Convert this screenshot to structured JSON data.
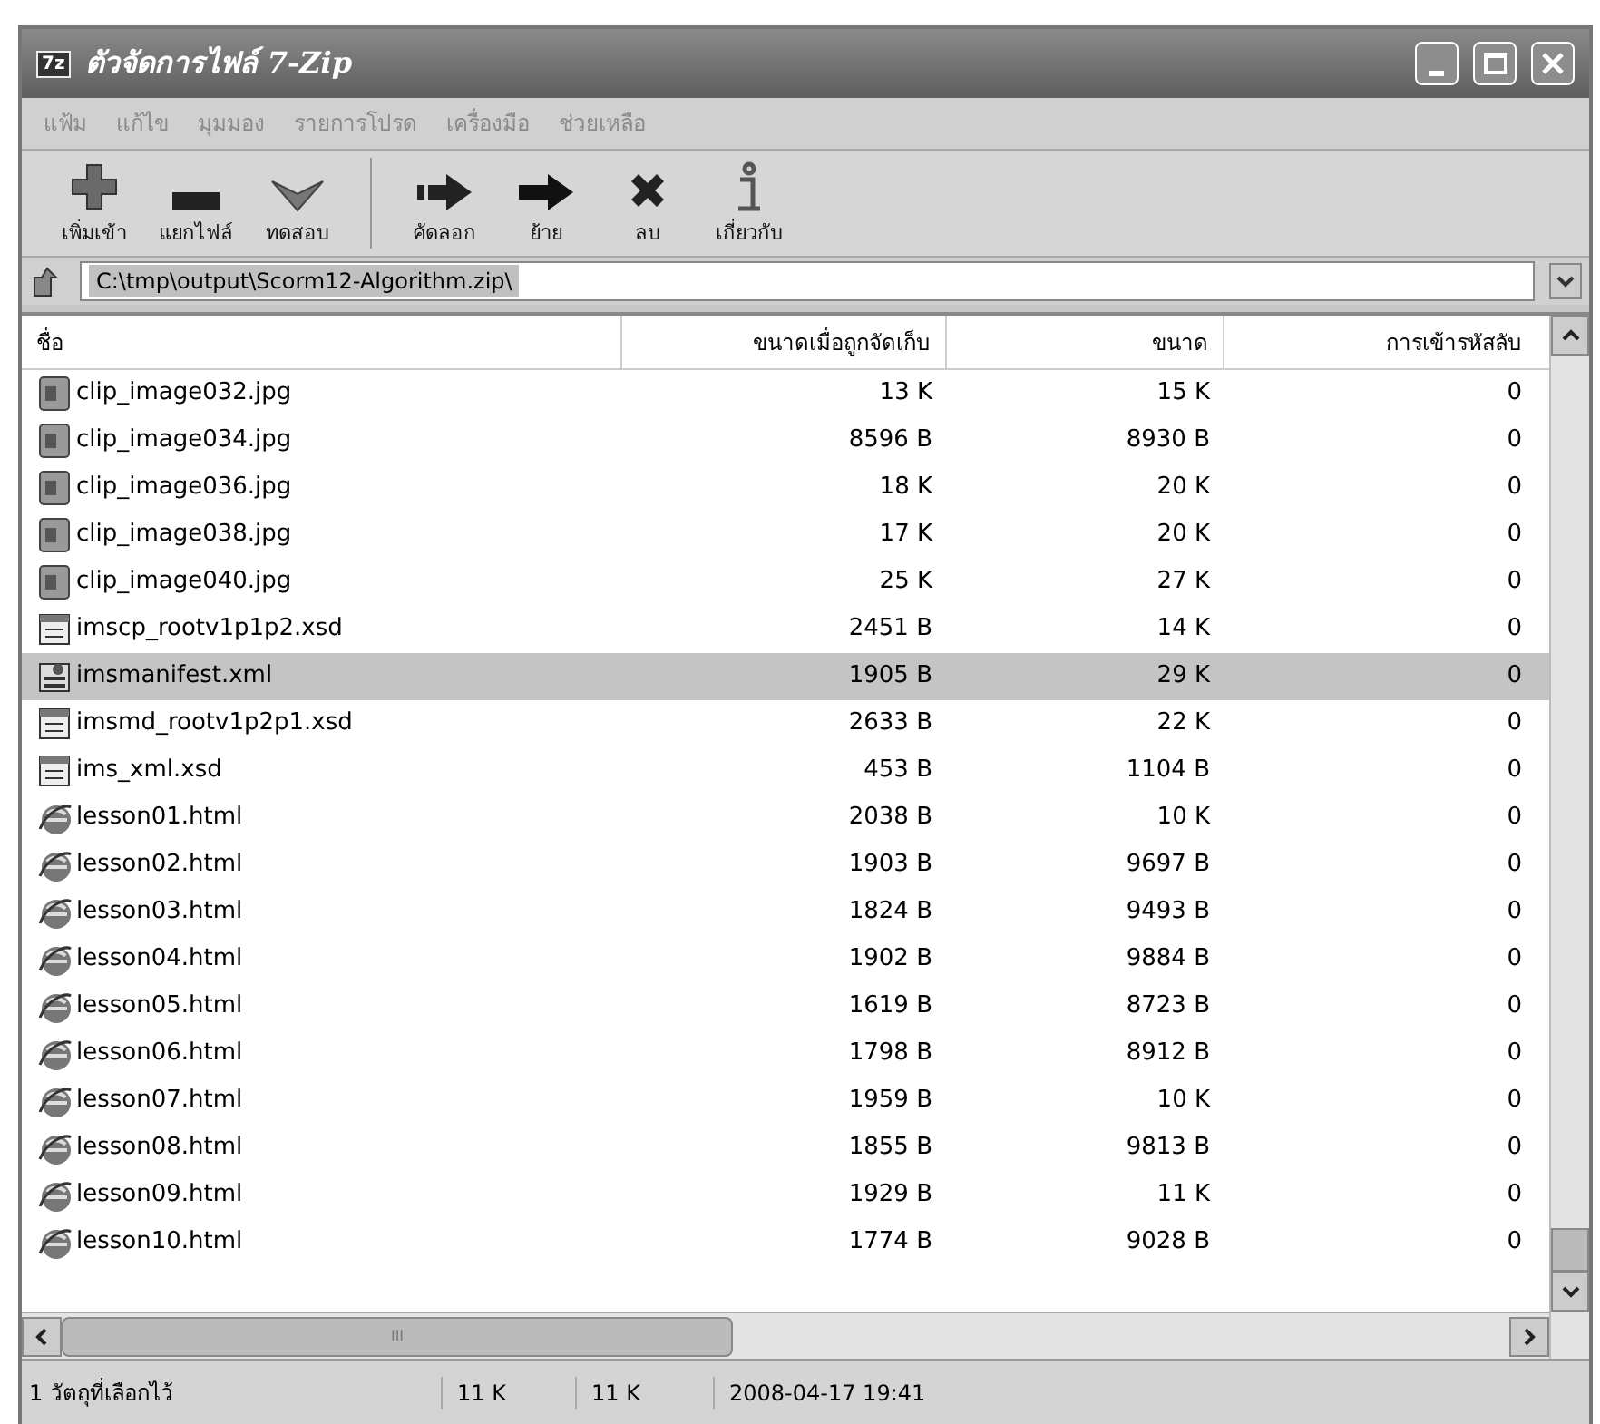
{
  "window": {
    "title": "ตัวจัดการไฟล์ 7-Zip",
    "app_badge": "7z"
  },
  "menu": [
    "แฟ้ม",
    "แก้ไข",
    "มุมมอง",
    "รายการโปรด",
    "เครื่องมือ",
    "ช่วยเหลือ"
  ],
  "toolbar": [
    {
      "kind": "add",
      "label": "เพิ่มเข้า"
    },
    {
      "kind": "extract",
      "label": "แยกไฟล์"
    },
    {
      "kind": "test",
      "label": "ทดสอบ"
    },
    {
      "kind": "copy",
      "label": "คัดลอก"
    },
    {
      "kind": "move",
      "label": "ย้าย"
    },
    {
      "kind": "delete",
      "label": "ลบ"
    },
    {
      "kind": "info",
      "label": "เกี่ยวกับ"
    }
  ],
  "address": {
    "value": "C:\\tmp\\output\\Scorm12-Algorithm.zip\\"
  },
  "table": {
    "columns": [
      "ชื่อ",
      "ขนาดเมื่อถูกจัดเก็บ",
      "ขนาด",
      "การเข้ารหัสลับ"
    ],
    "rows": [
      {
        "kind": "image",
        "name": "clip_image032.jpg",
        "packed": "13 K",
        "size": "15 K",
        "encrypted": "0",
        "selected": false
      },
      {
        "kind": "image",
        "name": "clip_image034.jpg",
        "packed": "8596 B",
        "size": "8930 B",
        "encrypted": "0",
        "selected": false
      },
      {
        "kind": "image",
        "name": "clip_image036.jpg",
        "packed": "18 K",
        "size": "20 K",
        "encrypted": "0",
        "selected": false
      },
      {
        "kind": "image",
        "name": "clip_image038.jpg",
        "packed": "17 K",
        "size": "20 K",
        "encrypted": "0",
        "selected": false
      },
      {
        "kind": "image",
        "name": "clip_image040.jpg",
        "packed": "25 K",
        "size": "27 K",
        "encrypted": "0",
        "selected": false
      },
      {
        "kind": "schema",
        "name": "imscp_rootv1p1p2.xsd",
        "packed": "2451 B",
        "size": "14 K",
        "encrypted": "0",
        "selected": false
      },
      {
        "kind": "xml",
        "name": "imsmanifest.xml",
        "packed": "1905 B",
        "size": "29 K",
        "encrypted": "0",
        "selected": true
      },
      {
        "kind": "schema",
        "name": "imsmd_rootv1p2p1.xsd",
        "packed": "2633 B",
        "size": "22 K",
        "encrypted": "0",
        "selected": false
      },
      {
        "kind": "schema",
        "name": "ims_xml.xsd",
        "packed": "453 B",
        "size": "1104 B",
        "encrypted": "0",
        "selected": false
      },
      {
        "kind": "html",
        "name": "lesson01.html",
        "packed": "2038 B",
        "size": "10 K",
        "encrypted": "0",
        "selected": false
      },
      {
        "kind": "html",
        "name": "lesson02.html",
        "packed": "1903 B",
        "size": "9697 B",
        "encrypted": "0",
        "selected": false
      },
      {
        "kind": "html",
        "name": "lesson03.html",
        "packed": "1824 B",
        "size": "9493 B",
        "encrypted": "0",
        "selected": false
      },
      {
        "kind": "html",
        "name": "lesson04.html",
        "packed": "1902 B",
        "size": "9884 B",
        "encrypted": "0",
        "selected": false
      },
      {
        "kind": "html",
        "name": "lesson05.html",
        "packed": "1619 B",
        "size": "8723 B",
        "encrypted": "0",
        "selected": false
      },
      {
        "kind": "html",
        "name": "lesson06.html",
        "packed": "1798 B",
        "size": "8912 B",
        "encrypted": "0",
        "selected": false
      },
      {
        "kind": "html",
        "name": "lesson07.html",
        "packed": "1959 B",
        "size": "10 K",
        "encrypted": "0",
        "selected": false
      },
      {
        "kind": "html",
        "name": "lesson08.html",
        "packed": "1855 B",
        "size": "9813 B",
        "encrypted": "0",
        "selected": false
      },
      {
        "kind": "html",
        "name": "lesson09.html",
        "packed": "1929 B",
        "size": "11 K",
        "encrypted": "0",
        "selected": false
      },
      {
        "kind": "html",
        "name": "lesson10.html",
        "packed": "1774 B",
        "size": "9028 B",
        "encrypted": "0",
        "selected": false
      }
    ]
  },
  "status_bar": {
    "selection": "1 วัตถุที่เลือกไว้",
    "packed": "11 K",
    "size": "11 K",
    "modified": "2008-04-17 19:41"
  },
  "scrollbar_grip": "III"
}
